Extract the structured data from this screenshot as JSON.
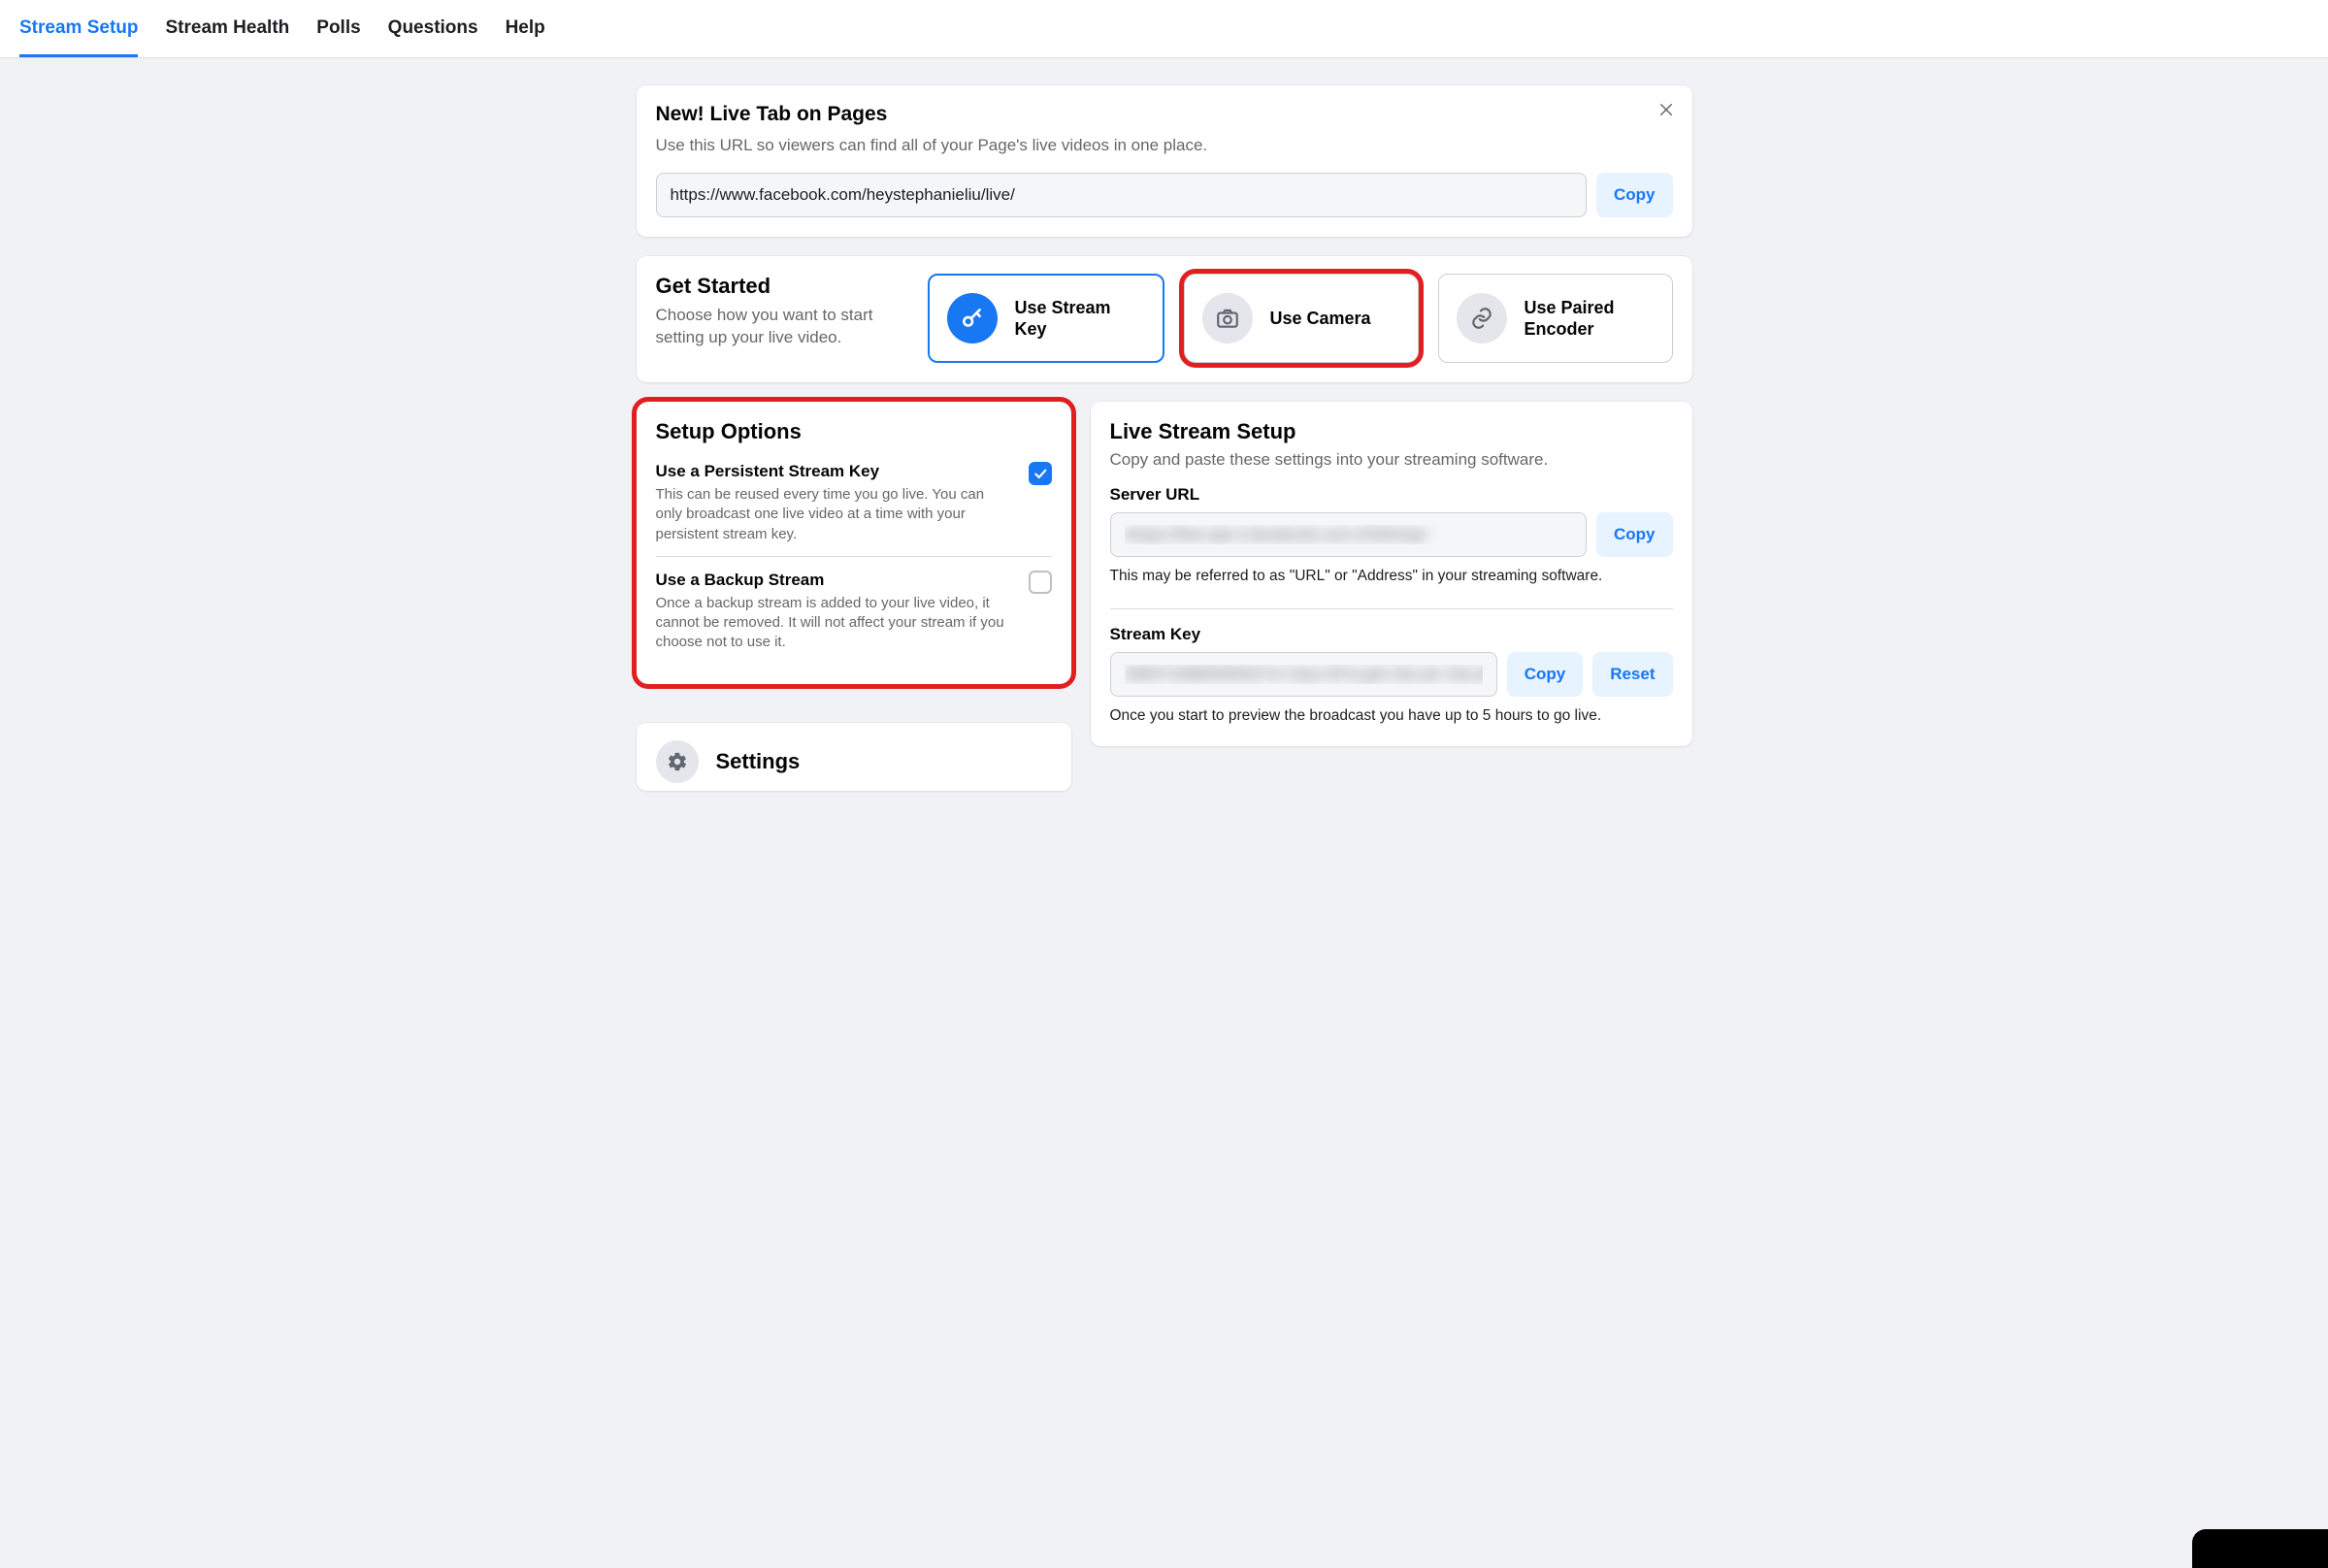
{
  "tabs": {
    "items": [
      {
        "label": "Stream Setup",
        "active": true
      },
      {
        "label": "Stream Health",
        "active": false
      },
      {
        "label": "Polls",
        "active": false
      },
      {
        "label": "Questions",
        "active": false
      },
      {
        "label": "Help",
        "active": false
      }
    ]
  },
  "banner": {
    "title": "New! Live Tab on Pages",
    "subtitle": "Use this URL so viewers can find all of your Page's live videos in one place.",
    "url_value": "https://www.facebook.com/heystephanieliu/live/",
    "copy_label": "Copy"
  },
  "get_started": {
    "title": "Get Started",
    "subtitle": "Choose how you want to start setting up your live video.",
    "options": [
      {
        "label": "Use Stream Key",
        "icon": "key-icon",
        "selected": true
      },
      {
        "label": "Use Camera",
        "icon": "camera-icon",
        "selected": false,
        "highlight": true
      },
      {
        "label": "Use Paired Encoder",
        "icon": "link-icon",
        "selected": false
      }
    ]
  },
  "setup_options": {
    "title": "Setup Options",
    "items": [
      {
        "title": "Use a Persistent Stream Key",
        "desc": "This can be reused every time you go live. You can only broadcast one live video at a time with your persistent stream key.",
        "checked": true
      },
      {
        "title": "Use a Backup Stream",
        "desc": "Once a backup stream is added to your live video, it cannot be removed. It will not affect your stream if you choose not to use it.",
        "checked": false
      }
    ]
  },
  "live_setup": {
    "title": "Live Stream Setup",
    "subtitle": "Copy and paste these settings into your streaming software.",
    "server_url_label": "Server URL",
    "server_url_value": "rtmps://live-api-s.facebook.com:443/rtmp/",
    "server_url_helper": "This may be referred to as \"URL\" or \"Address\" in your streaming software.",
    "stream_key_label": "Stream Key",
    "stream_key_value": "398371888938302?s=1&a=ATxLgN-1bLzkr-1bLzkv",
    "stream_key_helper": "Once you start to preview the broadcast you have up to 5 hours to go live.",
    "copy_label": "Copy",
    "reset_label": "Reset"
  },
  "settings": {
    "title": "Settings"
  }
}
